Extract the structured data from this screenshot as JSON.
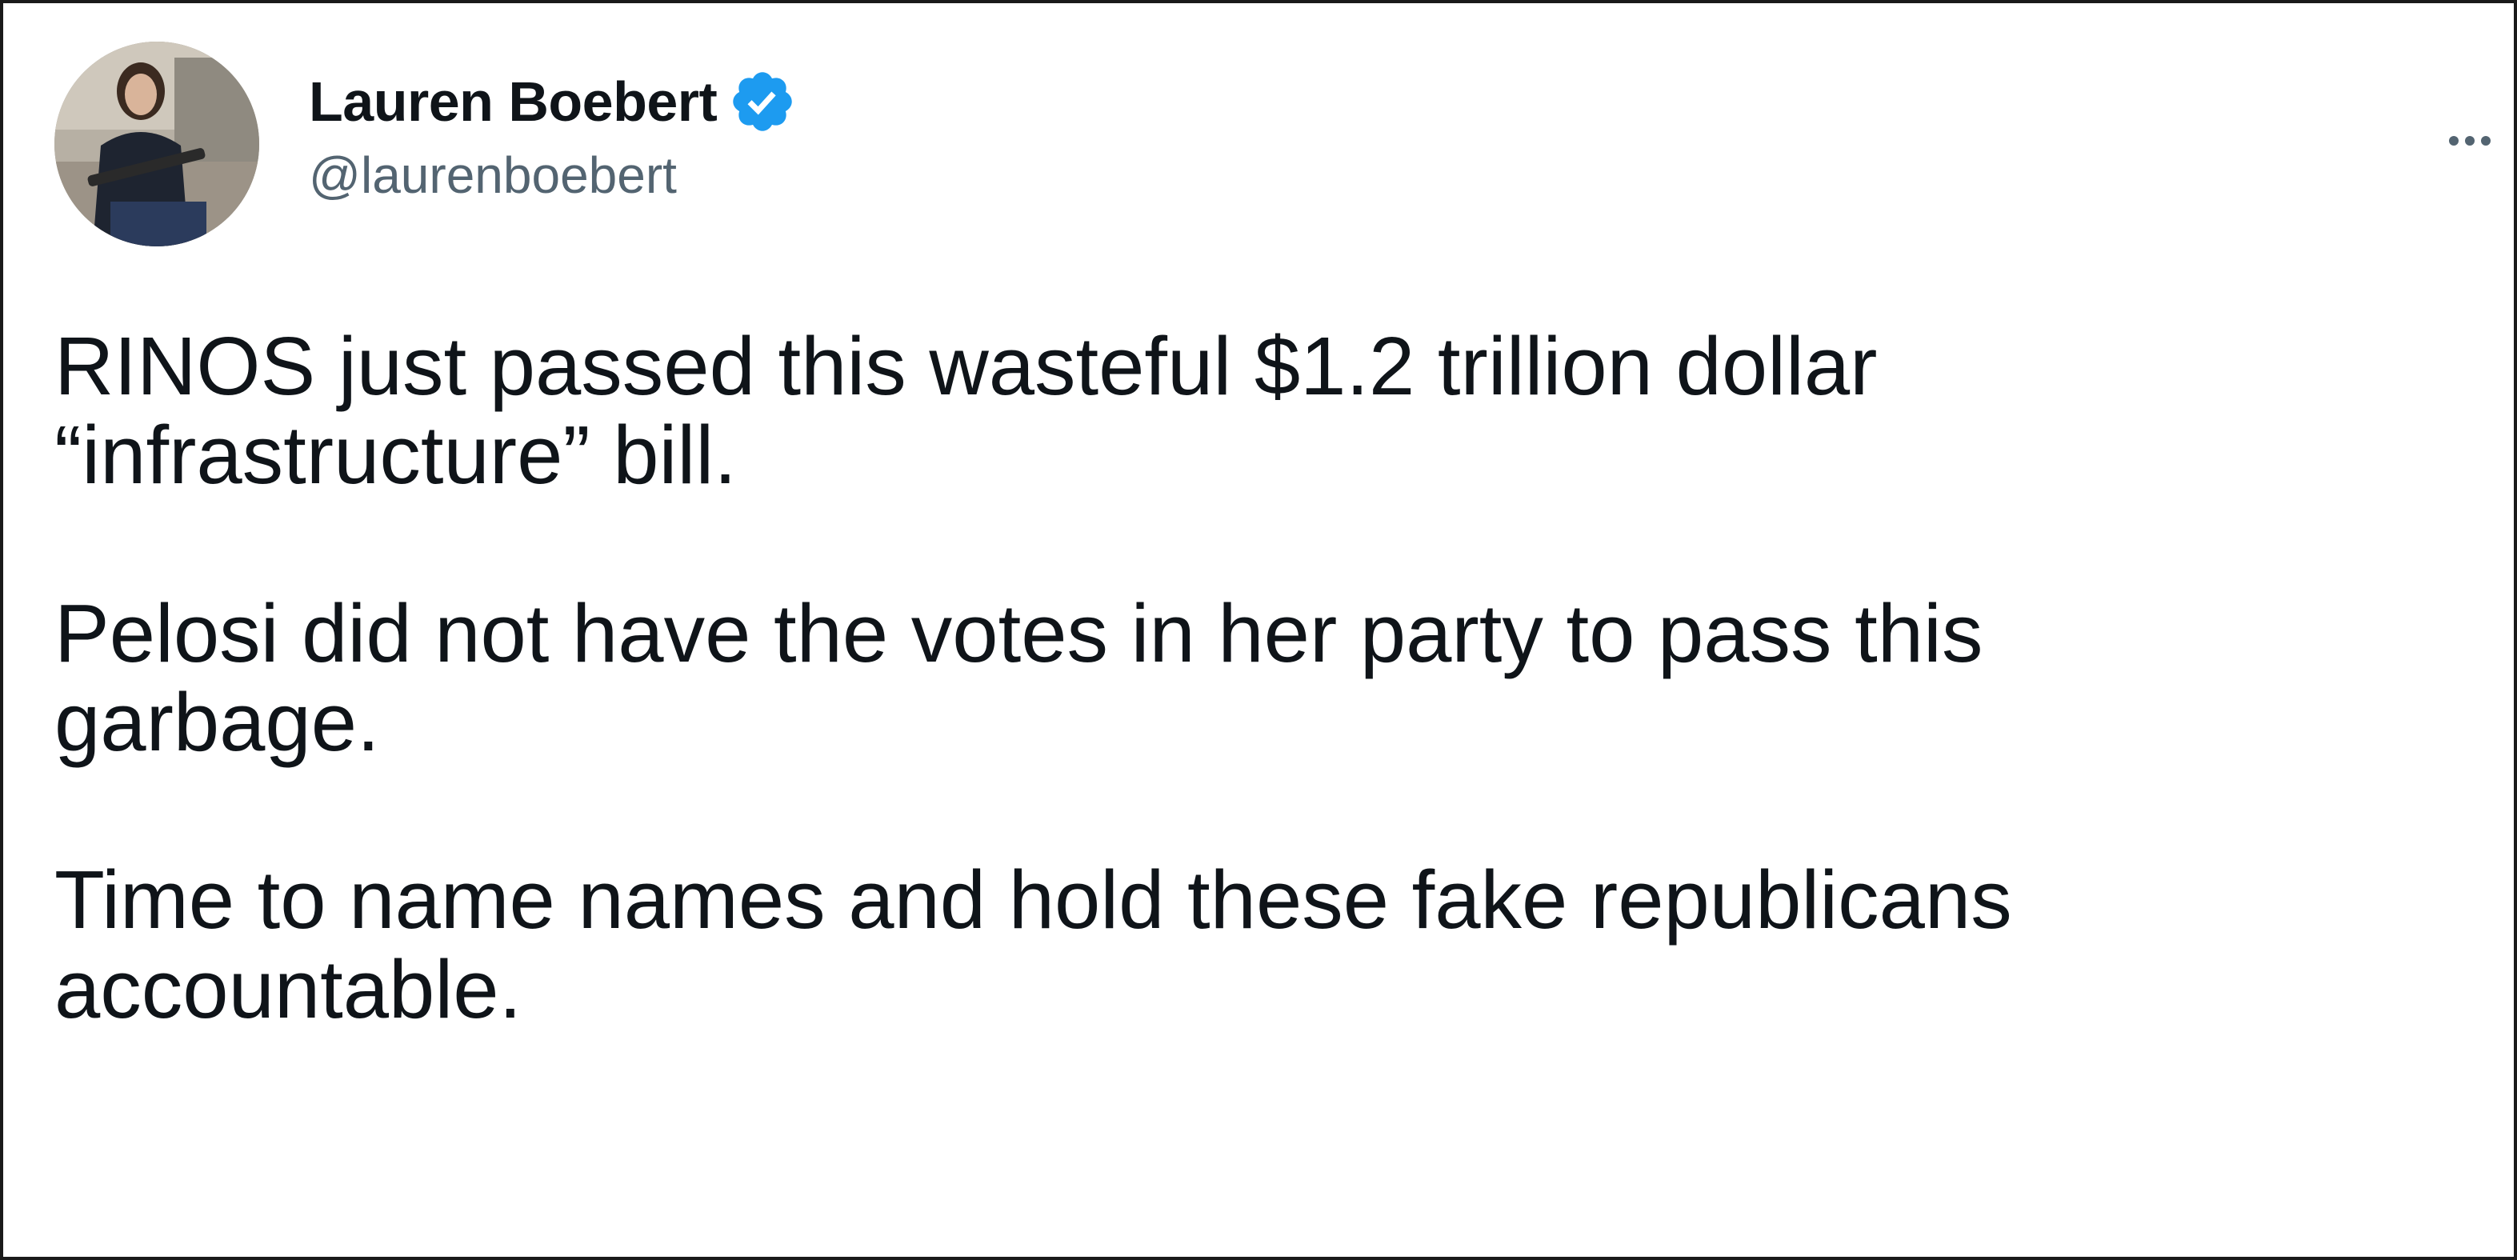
{
  "tweet": {
    "author": {
      "display_name": "Lauren Boebert",
      "handle": "@laurenboebert",
      "verified": true,
      "avatar_icon": "avatar-photo"
    },
    "more_icon": "more-options-icon",
    "text": "RINOS just passed this wasteful $1.2 trillion dollar\n“infrastructure” bill.\n\nPelosi did not have the votes in her party to pass this\ngarbage.\n\nTime to name names and hold these fake republicans\naccountable."
  },
  "colors": {
    "text_primary": "#0f1419",
    "text_secondary": "#536471",
    "verified_blue": "#1d9bf0",
    "frame_border": "#1a1a1a"
  }
}
